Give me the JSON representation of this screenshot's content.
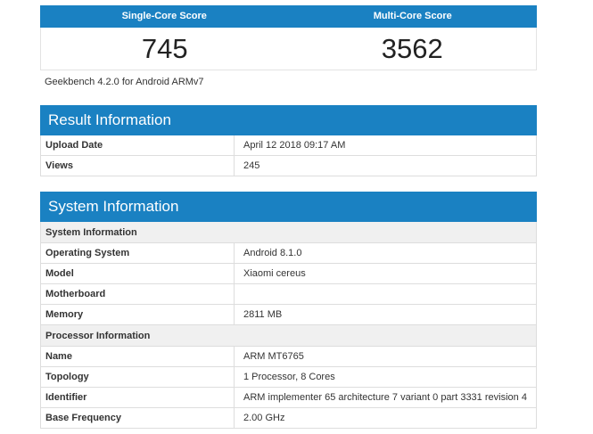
{
  "scores": {
    "single_label": "Single-Core Score",
    "multi_label": "Multi-Core Score",
    "single_value": "745",
    "multi_value": "3562"
  },
  "version_text": "Geekbench 4.2.0 for Android ARMv7",
  "result_info": {
    "title": "Result Information",
    "rows": [
      {
        "label": "Upload Date",
        "value": "April 12 2018 09:17 AM"
      },
      {
        "label": "Views",
        "value": "245"
      }
    ]
  },
  "system_info": {
    "title": "System Information",
    "sub_system": "System Information",
    "system_rows": [
      {
        "label": "Operating System",
        "value": "Android 8.1.0"
      },
      {
        "label": "Model",
        "value": "Xiaomi cereus"
      },
      {
        "label": "Motherboard",
        "value": ""
      },
      {
        "label": "Memory",
        "value": "2811 MB"
      }
    ],
    "sub_processor": "Processor Information",
    "processor_rows": [
      {
        "label": "Name",
        "value": "ARM MT6765"
      },
      {
        "label": "Topology",
        "value": "1 Processor, 8 Cores"
      },
      {
        "label": "Identifier",
        "value": "ARM implementer 65 architecture 7 variant 0 part 3331 revision 4"
      },
      {
        "label": "Base Frequency",
        "value": "2.00 GHz"
      }
    ]
  },
  "colors": {
    "header_blue": "#1a81c2",
    "subheader_bg": "#f0f0f0",
    "border": "#dddddd"
  }
}
